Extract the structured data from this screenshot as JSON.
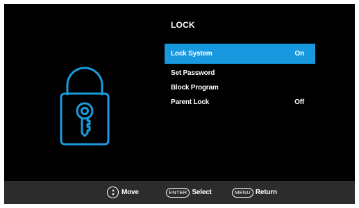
{
  "menu": {
    "title": "LOCK",
    "items": [
      {
        "label": "Lock System",
        "value": "On"
      },
      {
        "label": "Set Password",
        "value": ""
      },
      {
        "label": "Block Program",
        "value": ""
      },
      {
        "label": "Parent Lock",
        "value": "Off"
      }
    ]
  },
  "footer": {
    "move_label": "Move",
    "enter_key": "ENTER",
    "select_label": "Select",
    "menu_key": "MENU",
    "return_label": "Return"
  },
  "colors": {
    "background": "#000000",
    "highlight": "#1798df",
    "lock_icon": "#1b9be0",
    "footer": "#2c2c2c",
    "text": "#ffffff"
  },
  "icons": {
    "lock_graphic": "padlock-with-key-icon",
    "move_hint": "up-down-arrows-icon"
  }
}
